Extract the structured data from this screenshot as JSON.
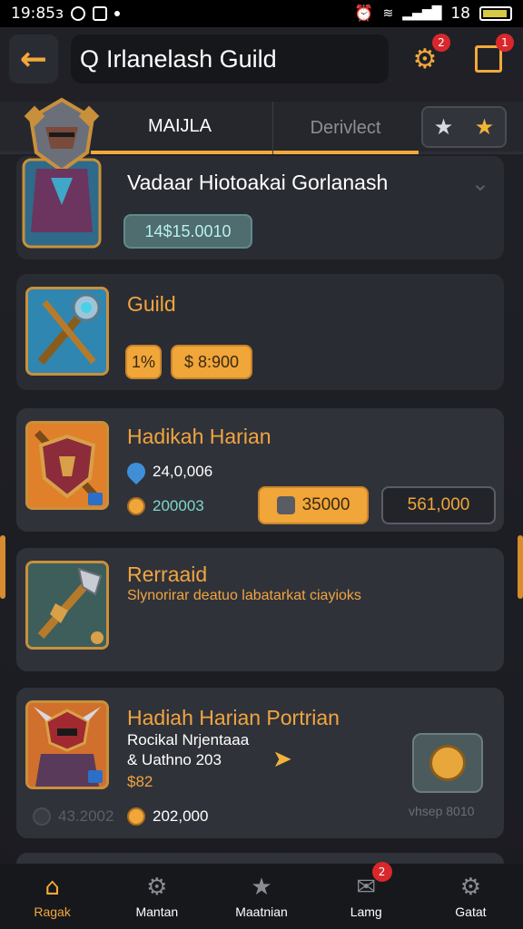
{
  "status_bar": {
    "time": "19:85з",
    "right_text": "18"
  },
  "header": {
    "back_icon": "arrow-left-icon",
    "search_prefix": "Q",
    "search_text": "Irlanelash Guild",
    "gear_badge": "2",
    "quest_badge": "1"
  },
  "tabs": {
    "active": "MAIJLA",
    "inactive": "Derivlect"
  },
  "cards": [
    {
      "title": "Vadaar Hiotoakai Gorlanash",
      "pill": "14$15.0010"
    },
    {
      "title": "Guild",
      "pill_small": "1%",
      "pill_price": "$ 8:900"
    },
    {
      "title": "Hadikah Harian",
      "line1": "24,0,006",
      "line2": "200003",
      "btn_gold": "35000",
      "btn_dark": "561,000"
    },
    {
      "title": "Rerraaid",
      "subtitle": "Slynorirar deatuo labatarkat ciayioks"
    },
    {
      "title": "Hadiah Harian Portrian",
      "line1": "Rocikal Nrjentaaa",
      "line2": "& Uathno 203",
      "price": "$82",
      "footer_left": "43.2002",
      "footer_mid": "202,000",
      "footer_right": "vhsep 8010"
    }
  ],
  "bottom_nav": [
    {
      "label": "Ragak",
      "icon": "home-icon"
    },
    {
      "label": "Mantan",
      "icon": "gear-icon"
    },
    {
      "label": "Maatnian",
      "icon": "star-icon"
    },
    {
      "label": "Lamg",
      "icon": "mail-icon",
      "badge": "2"
    },
    {
      "label": "Gatat",
      "icon": "settings-icon"
    }
  ],
  "colors": {
    "accent": "#f2a93b",
    "card_bg": "#2a2c33",
    "badge": "#d8282c",
    "teal": "#4f6c6e"
  }
}
